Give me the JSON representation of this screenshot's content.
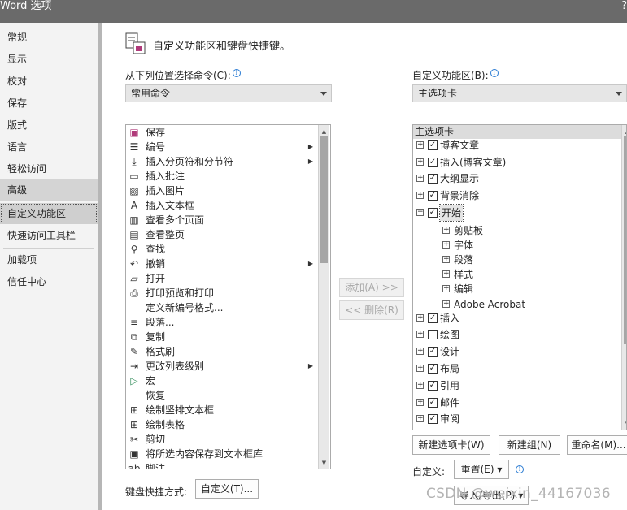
{
  "window": {
    "title": "Word 选项",
    "help_label": "?"
  },
  "nav": {
    "items": [
      {
        "label": "常规"
      },
      {
        "label": "显示"
      },
      {
        "label": "校对"
      },
      {
        "label": "保存"
      },
      {
        "label": "版式"
      },
      {
        "label": "语言"
      },
      {
        "label": "轻松访问"
      },
      {
        "label": "高级"
      },
      {
        "label": "自定义功能区"
      },
      {
        "label": "快速访问工具栏"
      },
      {
        "label": "加载项"
      },
      {
        "label": "信任中心"
      }
    ]
  },
  "header": {
    "title": "自定义功能区和键盘快捷键。",
    "icon": "customize-ribbon-icon"
  },
  "left_panel": {
    "label": "从下列位置选择命令(C):",
    "info": "i",
    "selected": "常用命令",
    "commands": [
      {
        "label": "保存",
        "icon": "save-icon",
        "glyph": "▣",
        "submenu": ""
      },
      {
        "label": "编号",
        "icon": "numbering-icon",
        "glyph": "☰",
        "submenu": "|▶"
      },
      {
        "label": "插入分页符和分节符",
        "icon": "page-break-icon",
        "glyph": "⤓",
        "submenu": "▶"
      },
      {
        "label": "插入批注",
        "icon": "comment-icon",
        "glyph": "▭",
        "submenu": ""
      },
      {
        "label": "插入图片",
        "icon": "picture-icon",
        "glyph": "▨",
        "submenu": ""
      },
      {
        "label": "插入文本框",
        "icon": "textbox-icon",
        "glyph": "A",
        "submenu": ""
      },
      {
        "label": "查看多个页面",
        "icon": "multiple-pages-icon",
        "glyph": "▥",
        "submenu": ""
      },
      {
        "label": "查看整页",
        "icon": "whole-page-icon",
        "glyph": "▤",
        "submenu": ""
      },
      {
        "label": "查找",
        "icon": "find-icon",
        "glyph": "⚲",
        "submenu": ""
      },
      {
        "label": "撤销",
        "icon": "undo-icon",
        "glyph": "↶",
        "submenu": "|▶"
      },
      {
        "label": "打开",
        "icon": "open-folder-icon",
        "glyph": "▱",
        "submenu": ""
      },
      {
        "label": "打印预览和打印",
        "icon": "print-preview-icon",
        "glyph": "⎙",
        "submenu": ""
      },
      {
        "label": "定义新编号格式...",
        "icon": "",
        "glyph": "",
        "submenu": ""
      },
      {
        "label": "段落...",
        "icon": "paragraph-icon",
        "glyph": "≡",
        "submenu": ""
      },
      {
        "label": "复制",
        "icon": "copy-icon",
        "glyph": "⧉",
        "submenu": ""
      },
      {
        "label": "格式刷",
        "icon": "format-painter-icon",
        "glyph": "✎",
        "submenu": ""
      },
      {
        "label": "更改列表级别",
        "icon": "list-level-icon",
        "glyph": "⇥",
        "submenu": "▶"
      },
      {
        "label": "宏",
        "icon": "macro-icon",
        "glyph": "▷",
        "submenu": ""
      },
      {
        "label": "恢复",
        "icon": "",
        "glyph": "",
        "submenu": ""
      },
      {
        "label": "绘制竖排文本框",
        "icon": "vertical-textbox-icon",
        "glyph": "⊞",
        "submenu": ""
      },
      {
        "label": "绘制表格",
        "icon": "draw-table-icon",
        "glyph": "⊞",
        "submenu": ""
      },
      {
        "label": "剪切",
        "icon": "cut-icon",
        "glyph": "✂",
        "submenu": ""
      },
      {
        "label": "将所选内容保存到文本框库",
        "icon": "save-selection-icon",
        "glyph": "▣",
        "submenu": ""
      },
      {
        "label": "脚注",
        "icon": "footnote-icon",
        "glyph": "ab",
        "submenu": ""
      }
    ]
  },
  "middle": {
    "add_label": "添加(A) >>",
    "remove_label": "<< 删除(R)"
  },
  "right_panel": {
    "label": "自定义功能区(B):",
    "info": "i",
    "selected": "主选项卡",
    "tree_header": "主选项卡",
    "tree": [
      {
        "label": "博客文章",
        "level": 0,
        "checked": true,
        "expander": "+"
      },
      {
        "label": "插入(博客文章)",
        "level": 0,
        "checked": true,
        "expander": "+"
      },
      {
        "label": "大纲显示",
        "level": 0,
        "checked": true,
        "expander": "+"
      },
      {
        "label": "背景消除",
        "level": 0,
        "checked": true,
        "expander": "+"
      },
      {
        "label": "开始",
        "level": 0,
        "checked": true,
        "expander": "−",
        "selected": true
      },
      {
        "label": "剪贴板",
        "level": 1,
        "expander": "+"
      },
      {
        "label": "字体",
        "level": 1,
        "expander": "+"
      },
      {
        "label": "段落",
        "level": 1,
        "expander": "+"
      },
      {
        "label": "样式",
        "level": 1,
        "expander": "+"
      },
      {
        "label": "编辑",
        "level": 1,
        "expander": "+"
      },
      {
        "label": "Adobe Acrobat",
        "level": 1,
        "expander": "+"
      },
      {
        "label": "插入",
        "level": 0,
        "checked": true,
        "expander": "+"
      },
      {
        "label": "绘图",
        "level": 0,
        "checked": false,
        "expander": "+"
      },
      {
        "label": "设计",
        "level": 0,
        "checked": true,
        "expander": "+"
      },
      {
        "label": "布局",
        "level": 0,
        "checked": true,
        "expander": "+"
      },
      {
        "label": "引用",
        "level": 0,
        "checked": true,
        "expander": "+"
      },
      {
        "label": "邮件",
        "level": 0,
        "checked": true,
        "expander": "+"
      },
      {
        "label": "审阅",
        "level": 0,
        "checked": true,
        "expander": "+"
      }
    ],
    "new_tab_label": "新建选项卡(W)",
    "new_group_label": "新建组(N)",
    "rename_label": "重命名(M)...",
    "customize_label": "自定义:",
    "reset_label": "重置(E) ▾",
    "import_export_label": "导入/导出(P) ▾"
  },
  "keyboard": {
    "label": "键盘快捷方式:",
    "button_label": "自定义(T)..."
  },
  "watermark": "CSDN @weixin_44167036"
}
